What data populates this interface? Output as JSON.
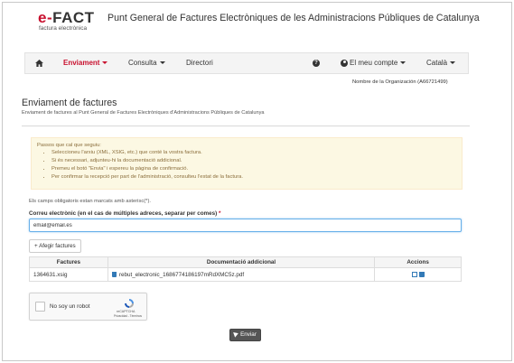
{
  "brand": {
    "logo_prefix": "e-",
    "logo_main": "FACT",
    "logo_sub": "factura electrònica",
    "site_title": "Punt General de Factures Electròniques de les Administracions Públiques de Catalunya",
    "accent_color": "#c8102e"
  },
  "nav": {
    "home_icon": "home-icon",
    "items": [
      {
        "label": "Enviament",
        "active": true,
        "dropdown": true
      },
      {
        "label": "Consulta",
        "active": false,
        "dropdown": true
      },
      {
        "label": "Directori",
        "active": false,
        "dropdown": false
      }
    ],
    "help_icon": "help-icon",
    "account_label": "El meu compte",
    "language_label": "Català"
  },
  "org_name": "Nombre de la Organización (A66721499)",
  "page": {
    "title": "Enviament de factures",
    "subtitle": "Enviament de factures al Punt General de Factures Electròniques d'Administracions Públiques de Catalunya"
  },
  "steps": {
    "title": "Passos que cal que seguiu:",
    "items": [
      "Seleccioneu l'arxiu (XML, XSIG, etc.) que conté la vostra factura.",
      "Si és necessari, adjunteu-hi la documentació addicional.",
      "Premeu el botó \"Envia\" i espereu la pàgina de confirmació.",
      "Per confirmar la recepció per part de l'administració, consulteu l'estat de la factura."
    ]
  },
  "form": {
    "required_note": "Els camps obligatoris estan marcats amb asterisc(*).",
    "email_label": "Correu electrònic (en el cas de múltiples adreces, separar per comes)",
    "email_required_mark": "*",
    "email_value": "email@email.es",
    "add_invoices_label": "+ Afegir factures"
  },
  "table": {
    "headers": [
      "Factures",
      "Documentació addicional",
      "Accions"
    ],
    "rows": [
      {
        "invoice": "1364631.xsig",
        "attachment": "rebut_electronic_1686774186197mRdXMC5z.pdf"
      }
    ]
  },
  "captcha": {
    "label": "No soy un robot",
    "brand": "reCAPTCHA",
    "links": "Privacidad - Términos"
  },
  "submit": {
    "label": "Enviar"
  }
}
